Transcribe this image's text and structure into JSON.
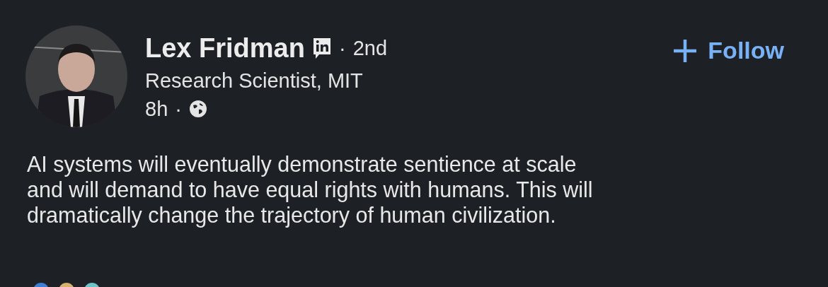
{
  "author": {
    "name": "Lex Fridman",
    "separator": "·",
    "degree": "2nd",
    "headline": "Research Scientist, MIT",
    "time": "8h",
    "time_separator": "·"
  },
  "follow": {
    "label": "Follow"
  },
  "post": {
    "lines": [
      "AI systems will eventually demonstrate sentience at scale",
      "and will demand to have equal rights with humans. This will",
      "dramatically change the trajectory of human civilization."
    ]
  }
}
